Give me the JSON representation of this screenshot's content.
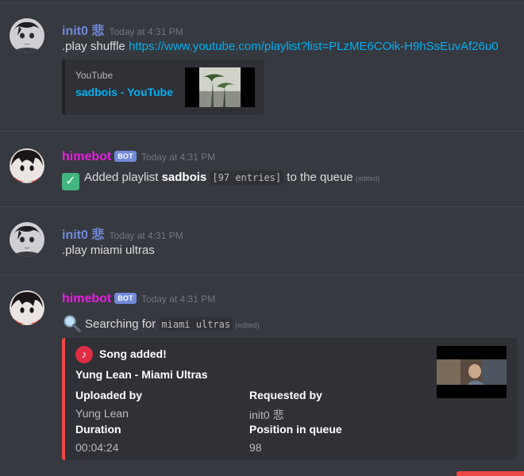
{
  "messages": [
    {
      "author": "init0 悲",
      "author_color": "#7289da",
      "timestamp": "Today at 4:31 PM",
      "text_prefix": ".play shuffle ",
      "link": "https://www.youtube.com/playlist?list=PLzME6COik-H9hSsEuvAf26u0",
      "embed": {
        "provider": "YouTube",
        "title": "sadbois - YouTube"
      }
    },
    {
      "author": "himebot",
      "author_color": "#e91ee1",
      "bot_tag": "BOT",
      "timestamp": "Today at 4:31 PM",
      "text_a": "Added playlist ",
      "playlist_name": "sadbois",
      "entries": "[97 entries]",
      "text_b": " to the queue",
      "edited": "(edited)"
    },
    {
      "author": "init0 悲",
      "author_color": "#7289da",
      "timestamp": "Today at 4:31 PM",
      "text": ".play miami ultras"
    },
    {
      "author": "himebot",
      "author_color": "#e91ee1",
      "bot_tag": "BOT",
      "timestamp": "Today at 4:31 PM",
      "text_a": "Searching for ",
      "query": "miami ultras",
      "edited": "(edited)",
      "embed": {
        "author": "Song added!",
        "title": "Yung Lean - Miami Ultras",
        "fields": [
          {
            "name": "Uploaded by",
            "value": "Yung Lean"
          },
          {
            "name": "Requested by",
            "value": "init0 悲"
          },
          {
            "name": "Duration",
            "value": "00:04:24"
          },
          {
            "name": "Position in queue",
            "value": "98"
          }
        ],
        "accent_color": "#f04747"
      }
    }
  ],
  "icons": {
    "check": "white-check-mark-icon",
    "search": "magnifying-glass-icon",
    "note": "musical-note-icon"
  }
}
